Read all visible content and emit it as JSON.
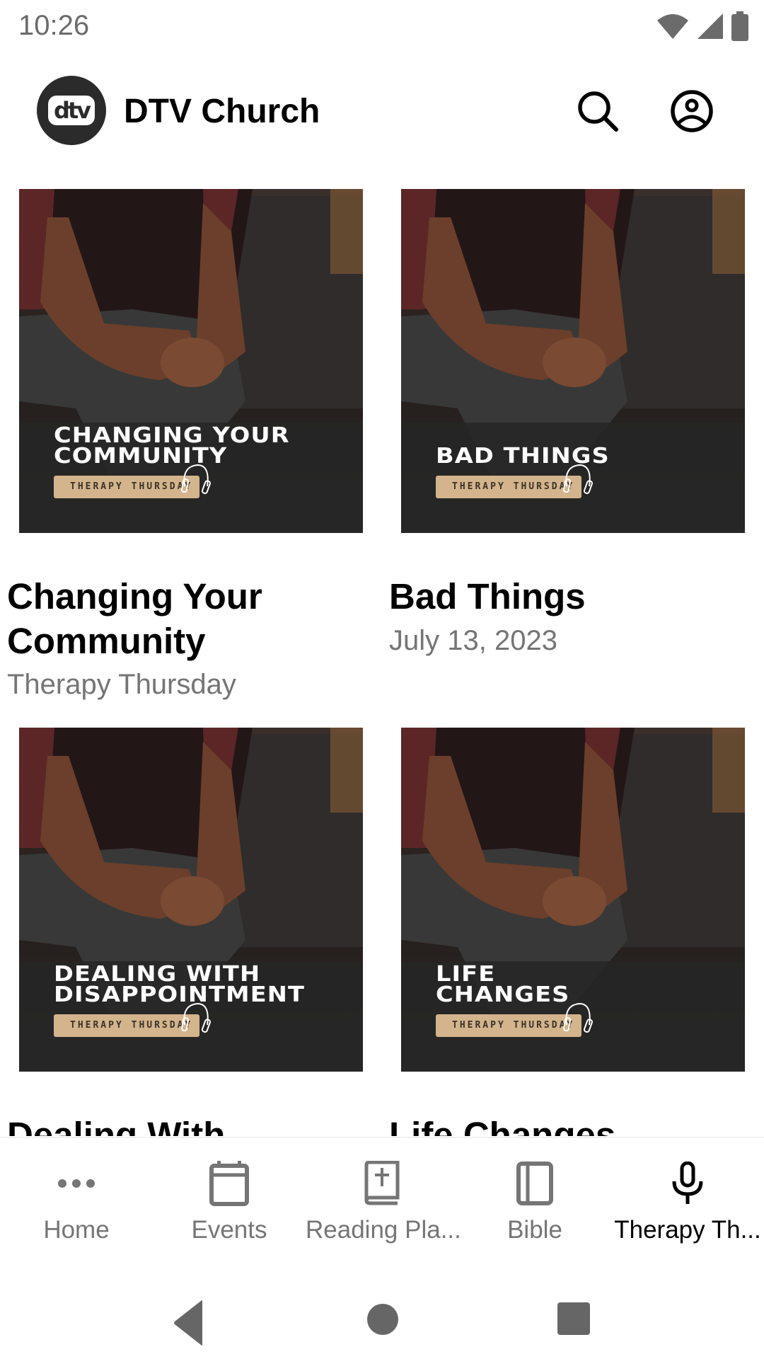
{
  "status_bar": {
    "time": "10:26",
    "icons": [
      "wifi-icon",
      "cell-signal-icon",
      "battery-icon"
    ]
  },
  "app_bar": {
    "logo_text": "dtv",
    "title": "DTV Church",
    "actions": [
      "search-icon",
      "account-circle-icon"
    ]
  },
  "cards": [
    {
      "overlay_lines": [
        "CHANGING YOUR",
        "COMMUNITY"
      ],
      "badge": "THERAPY THURSDAY",
      "title_lines": [
        "Changing Your",
        "Community"
      ],
      "subtitle": "Therapy Thursday"
    },
    {
      "overlay_lines": [
        "BAD THINGS"
      ],
      "badge": "THERAPY THURSDAY",
      "title_lines": [
        "Bad Things"
      ],
      "subtitle": "July 13, 2023"
    },
    {
      "overlay_lines": [
        "DEALING WITH",
        "DISAPPOINTMENT"
      ],
      "badge": "THERAPY THURSDAY",
      "title_lines": [
        "Dealing With"
      ],
      "subtitle": ""
    },
    {
      "overlay_lines": [
        "LIFE",
        "CHANGES"
      ],
      "badge": "THERAPY THURSDAY",
      "title_lines": [
        "Life Changes"
      ],
      "subtitle": ""
    }
  ],
  "bottom_nav": {
    "items": [
      {
        "label": "Home",
        "icon": "more-horiz-icon",
        "active": false
      },
      {
        "label": "Events",
        "icon": "calendar-icon",
        "active": false
      },
      {
        "label": "Reading Pla...",
        "icon": "bible-book-icon",
        "active": false
      },
      {
        "label": "Bible",
        "icon": "book-icon",
        "active": false
      },
      {
        "label": "Therapy Th...",
        "icon": "microphone-icon",
        "active": true
      }
    ]
  },
  "system_nav": [
    "back",
    "home",
    "recents"
  ],
  "colors": {
    "badge": "#d4b48c",
    "active": "#000000",
    "inactive": "#757575",
    "logo_bg": "#2b2b2b"
  }
}
